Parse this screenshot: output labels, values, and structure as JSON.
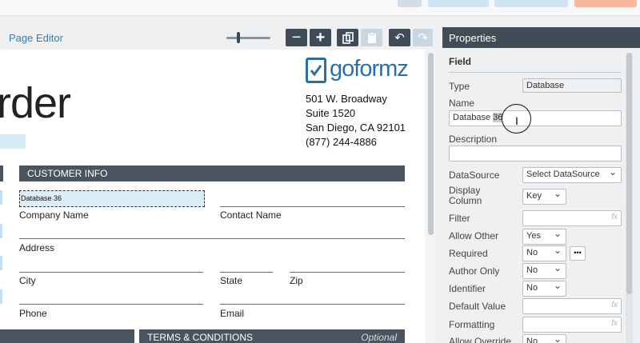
{
  "editor": {
    "title": "Page Editor",
    "toolbar": [
      {
        "id": "zoom-out",
        "glyph": "−"
      },
      {
        "id": "zoom-in",
        "glyph": "+"
      },
      {
        "id": "copy",
        "glyph": "⧉"
      },
      {
        "id": "paste",
        "glyph": "📋"
      },
      {
        "id": "undo",
        "glyph": "↶"
      },
      {
        "id": "redo",
        "glyph": "↷"
      }
    ]
  },
  "form": {
    "title": "rder",
    "logo_text": "goformz",
    "address": [
      "501 W. Broadway",
      "Suite 1520",
      "San Diego, CA 92101",
      "(877) 244-4886"
    ],
    "section_customer": "CUSTOMER INFO",
    "section_terms": "TERMS & CONDITIONS",
    "terms_optional": "Optional",
    "selected_field": "Database 36",
    "field_labels": {
      "company": "Company Name",
      "contact": "Contact Name",
      "address": "Address",
      "city": "City",
      "state": "State",
      "zip": "Zip",
      "phone": "Phone",
      "email": "Email"
    }
  },
  "properties": {
    "header": "Properties",
    "section": "Field",
    "type_label": "Type",
    "type_value": "Database",
    "name_label": "Name",
    "name_value_plain": "Database ",
    "name_value_selected": "36",
    "description_label": "Description",
    "description_value": "",
    "datasource_label": "DataSource",
    "datasource_value": "Select DataSource",
    "display_column_label": "Display\nColumn",
    "display_column_value": "Key",
    "filter_label": "Filter",
    "filter_value": "",
    "allow_other_label": "Allow Other",
    "allow_other_value": "Yes",
    "required_label": "Required",
    "required_value": "No",
    "author_only_label": "Author Only",
    "author_only_value": "No",
    "identifier_label": "Identifier",
    "identifier_value": "No",
    "default_value_label": "Default Value",
    "default_value_value": "",
    "formatting_label": "Formatting",
    "formatting_value": "",
    "allow_override_label": "Allow Override",
    "allow_override_value": "No",
    "fx": "fx",
    "more": "•••"
  },
  "colors": {
    "accent": "#2f7fb5",
    "panel_header": "#414c57",
    "section_bar": "#4a545e",
    "selected_field": "#dcedf8"
  }
}
